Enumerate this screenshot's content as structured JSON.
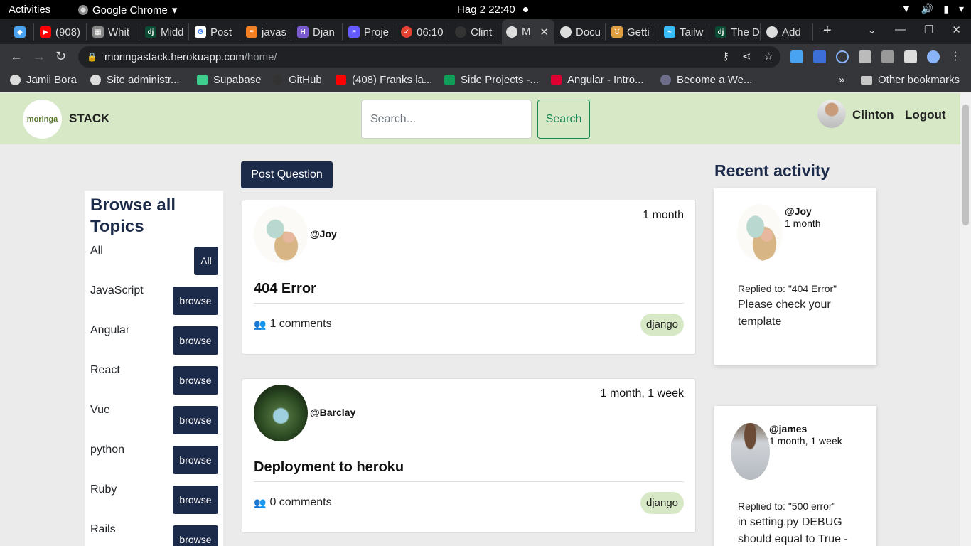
{
  "gnome": {
    "activities": "Activities",
    "app_name": "Google Chrome",
    "clock": "Hag 2  22:40"
  },
  "tabs": [
    {
      "label": "",
      "icon": "gem-icon",
      "color": "#4aa3f0"
    },
    {
      "label": "(908)",
      "icon": "youtube-icon",
      "color": "#ff0000"
    },
    {
      "label": "Whit",
      "icon": "doc-icon",
      "color": "#888888"
    },
    {
      "label": "Midd",
      "icon": "django-icon",
      "color": "#0c4b33"
    },
    {
      "label": "Post",
      "icon": "google-icon",
      "color": "#ffffff"
    },
    {
      "label": "javas",
      "icon": "stack-icon",
      "color": "#f48024"
    },
    {
      "label": "Djan",
      "icon": "h-icon",
      "color": "#7a5bd0"
    },
    {
      "label": "Proje",
      "icon": "stripe-icon",
      "color": "#635bff"
    },
    {
      "label": "06:10",
      "icon": "todo-icon",
      "color": "#e44232"
    },
    {
      "label": "Clint",
      "icon": "github-icon",
      "color": "#333333"
    },
    {
      "label": "M",
      "icon": "globe-icon",
      "color": "#dddddd"
    },
    {
      "label": "Docu",
      "icon": "globe-icon",
      "color": "#dddddd"
    },
    {
      "label": "Getti",
      "icon": "tauri-icon",
      "color": "#e0a040"
    },
    {
      "label": "Tailw",
      "icon": "tailwind-icon",
      "color": "#38bdf8"
    },
    {
      "label": "The D",
      "icon": "django-icon",
      "color": "#0c4b33"
    },
    {
      "label": "Add",
      "icon": "globe-icon",
      "color": "#dddddd"
    }
  ],
  "address": {
    "host": "moringastack.herokuapp.com",
    "path": "/home/"
  },
  "bookmarks": [
    {
      "label": "Jamii Bora",
      "icon": "globe-icon",
      "color": "#dddddd"
    },
    {
      "label": "Site administr...",
      "icon": "globe-icon",
      "color": "#dddddd"
    },
    {
      "label": "Supabase",
      "icon": "supabase-icon",
      "color": "#3ecf8e"
    },
    {
      "label": "GitHub",
      "icon": "github-icon",
      "color": "#333333"
    },
    {
      "label": "(408) Franks la...",
      "icon": "youtube-icon",
      "color": "#ff0000"
    },
    {
      "label": "Side Projects -...",
      "icon": "sheets-icon",
      "color": "#0f9d58"
    },
    {
      "label": "Angular - Intro...",
      "icon": "angular-icon",
      "color": "#dd0031"
    },
    {
      "label": "Become a We...",
      "icon": "v-icon",
      "color": "#6e6e8a"
    }
  ],
  "bookmarks_other": "Other bookmarks",
  "site": {
    "logo_text": "moringa",
    "brand": "STACK",
    "search_placeholder": "Search...",
    "search_button": "Search",
    "username": "Clinton",
    "logout": "Logout"
  },
  "topics": {
    "heading": "Browse all Topics",
    "items": [
      {
        "name": "All",
        "button": "All"
      },
      {
        "name": "JavaScript",
        "button": "browse"
      },
      {
        "name": "Angular",
        "button": "browse"
      },
      {
        "name": "React",
        "button": "browse"
      },
      {
        "name": "Vue",
        "button": "browse"
      },
      {
        "name": "python",
        "button": "browse"
      },
      {
        "name": "Ruby",
        "button": "browse"
      },
      {
        "name": "Rails",
        "button": "browse"
      }
    ]
  },
  "feed": {
    "post_question": "Post Question",
    "posts": [
      {
        "author": "@Joy",
        "time": "1 month",
        "title": "404 Error",
        "comments": "1 comments",
        "tag": "django"
      },
      {
        "author": "@Barclay",
        "time": "1 month, 1 week",
        "title": "Deployment to heroku",
        "comments": "0 comments",
        "tag": "django"
      }
    ]
  },
  "recent": {
    "title": "Recent activity",
    "items": [
      {
        "author": "@Joy",
        "time": "1 month",
        "replied": "Replied to: \"404 Error\"",
        "body": "Please check your template"
      },
      {
        "author": "@james",
        "time": "1 month, 1 week",
        "replied": "Replied to: \"500 error\"",
        "body": "in setting.py DEBUG should equal to True -"
      }
    ]
  },
  "colors": {
    "header_bg": "#d7e8c7",
    "navy": "#1c2b4a",
    "success": "#198754"
  }
}
